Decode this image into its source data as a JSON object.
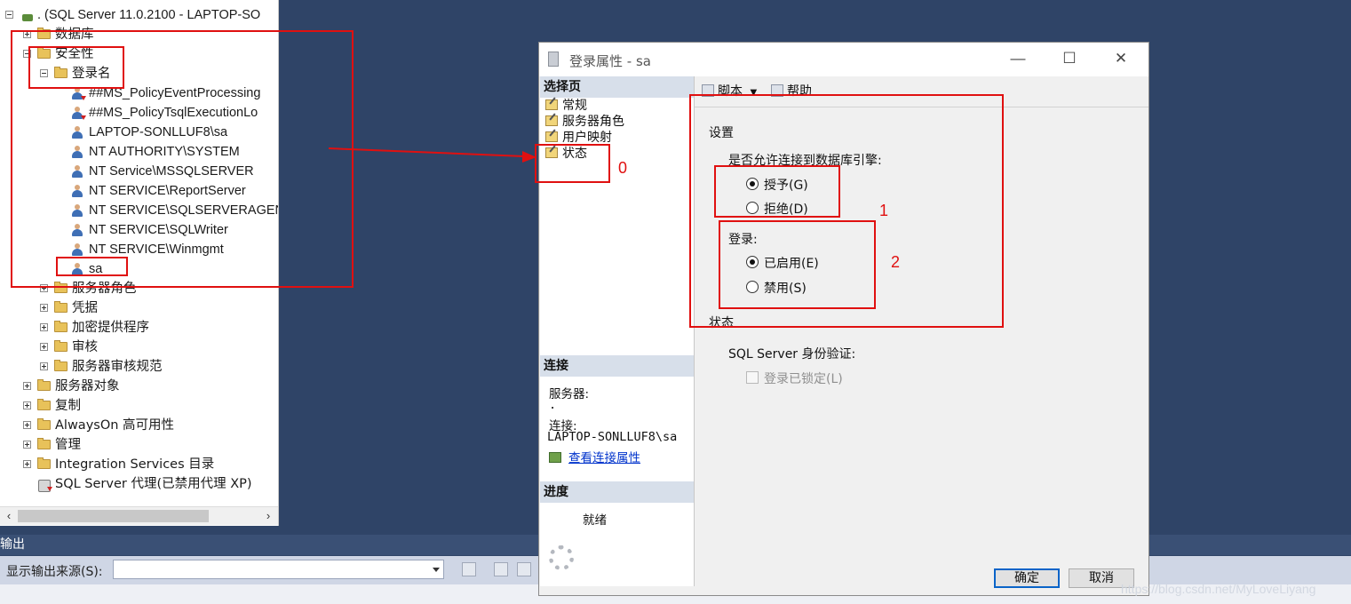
{
  "explorer": {
    "root": ". (SQL Server 11.0.2100 - LAPTOP-SO",
    "databases": "数据库",
    "security": "安全性",
    "logins": "登录名",
    "login_items": [
      "##MS_PolicyEventProcessing",
      "##MS_PolicyTsqlExecutionLo",
      "LAPTOP-SONLLUF8\\sa",
      "NT AUTHORITY\\SYSTEM",
      "NT Service\\MSSQLSERVER",
      "NT SERVICE\\ReportServer",
      "NT SERVICE\\SQLSERVERAGEN",
      "NT SERVICE\\SQLWriter",
      "NT SERVICE\\Winmgmt",
      "sa"
    ],
    "security_children": [
      "服务器角色",
      "凭据",
      "加密提供程序",
      "审核",
      "服务器审核规范"
    ],
    "server_children": [
      "服务器对象",
      "复制",
      "AlwaysOn 高可用性",
      "管理",
      "Integration Services 目录"
    ],
    "agent": "SQL Server 代理(已禁用代理 XP)"
  },
  "output": {
    "title": "输出",
    "source_label": "显示输出来源(S):",
    "source_value": ""
  },
  "dialog": {
    "title": "登录属性 - sa",
    "select_page_header": "选择页",
    "pages": [
      "常规",
      "服务器角色",
      "用户映射",
      "状态"
    ],
    "toolbar": {
      "script": "脚本",
      "help": "帮助"
    },
    "settings_label": "设置",
    "permission_question": "是否允许连接到数据库引擎:",
    "grant": "授予(G)",
    "deny": "拒绝(D)",
    "login_label": "登录:",
    "enabled": "已启用(E)",
    "disabled": "禁用(S)",
    "status_label": "状态",
    "auth_label": "SQL Server 身份验证:",
    "locked": "登录已锁定(L)",
    "connection_header": "连接",
    "server_label": "服务器:",
    "server_value": ".",
    "connection_label": "连接:",
    "connection_value": "LAPTOP-SONLLUF8\\sa",
    "view_conn_props": "查看连接属性",
    "progress_header": "进度",
    "progress_status": "就绪",
    "ok": "确定",
    "cancel": "取消",
    "grant_selected": true,
    "enabled_selected": true
  },
  "annotations": [
    "0",
    "1",
    "2"
  ],
  "colors": {
    "annotation": "#e01010",
    "link": "#0033cc",
    "background": "#2f4467"
  },
  "watermark": "https://blog.csdn.net/MyLoveLiyang"
}
